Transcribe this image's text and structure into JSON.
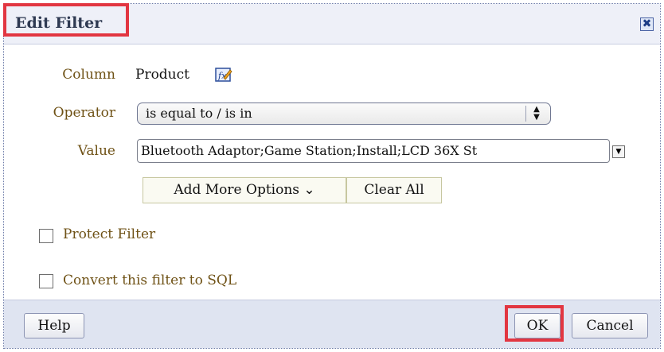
{
  "dialog": {
    "title": "Edit Filter",
    "close_symbol": "✖"
  },
  "form": {
    "column_label": "Column",
    "column_value": "Product",
    "column_icon": "edit-formula-icon",
    "operator_label": "Operator",
    "operator_value": "is equal to / is in",
    "value_label": "Value",
    "value_text": "Bluetooth Adaptor;Game Station;Install;LCD 36X St",
    "add_more_options": "Add More Options",
    "add_more_chevron": "⌄",
    "clear_all": "Clear All",
    "protect_filter": "Protect Filter",
    "convert_sql": "Convert this filter to SQL"
  },
  "footer": {
    "help": "Help",
    "ok": "OK",
    "cancel": "Cancel"
  },
  "colors": {
    "highlight": "#e23641",
    "label": "#6f5216"
  }
}
